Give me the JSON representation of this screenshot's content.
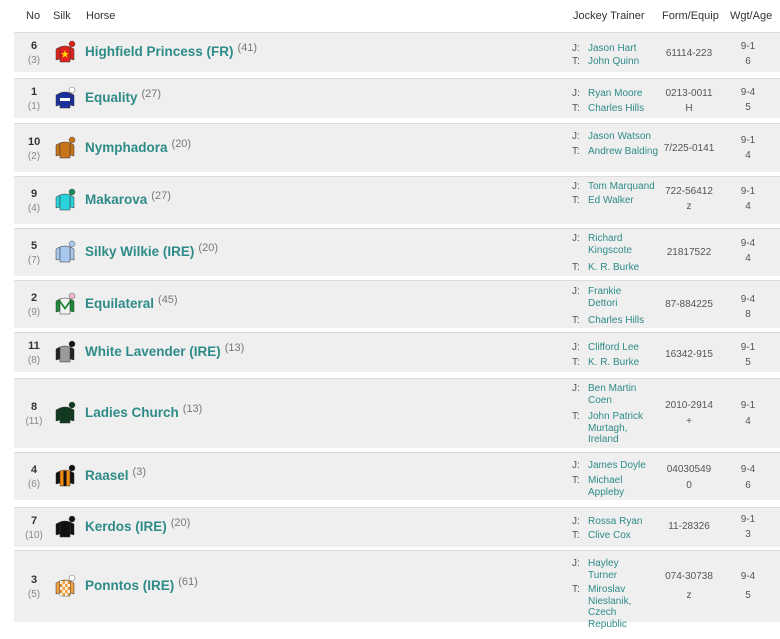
{
  "columns": {
    "no": "No",
    "silk": "Silk",
    "horse": "Horse",
    "jockey_trainer": "Jockey Trainer",
    "form_equip": "Form/Equip",
    "wgt_age": "Wgt/Age"
  },
  "labels": {
    "jockey": "J:",
    "trainer": "T:"
  },
  "runners": [
    {
      "no": "6",
      "draw": "(3)",
      "horse": "Highfield Princess (FR)",
      "age": "(41)",
      "jockey": "Jason Hart",
      "trainer": "John Quinn",
      "form": "61114-223",
      "equip": "",
      "wgt": "9-1",
      "ag": "6",
      "silk": {
        "icon": "red-silk-yellow-star-icon",
        "body": "#e0231b",
        "sleeves": "#e0231b",
        "cap": "#e0231b",
        "pattern": "star",
        "pattern_color": "#ffd700"
      }
    },
    {
      "no": "1",
      "draw": "(1)",
      "horse": "Equality",
      "age": "(27)",
      "jockey": "Ryan Moore",
      "trainer": "Charles Hills",
      "form": "0213-0011",
      "equip": "H",
      "wgt": "9-4",
      "ag": "5",
      "silk": {
        "icon": "royal-blue-silk-white-hoop-icon",
        "body": "#1a2fa0",
        "sleeves": "#1a2fa0",
        "cap": "#ffffff",
        "pattern": "hoop",
        "pattern_color": "#ffffff"
      }
    },
    {
      "no": "10",
      "draw": "(2)",
      "horse": "Nymphadora",
      "age": "(20)",
      "jockey": "Jason Watson",
      "trainer": "Andrew Balding",
      "form": "7/225-0141",
      "equip": "",
      "wgt": "9-1",
      "ag": "4",
      "silk": {
        "icon": "orange-brown-silk-icon",
        "body": "#c8741a",
        "sleeves": "#c8741a",
        "cap": "#c8741a",
        "pattern": "none",
        "pattern_color": ""
      }
    },
    {
      "no": "9",
      "draw": "(4)",
      "horse": "Makarova",
      "age": "(27)",
      "jockey": "Tom Marquand",
      "trainer": "Ed Walker",
      "form": "722-56412",
      "equip": "z",
      "wgt": "9-1",
      "ag": "4",
      "silk": {
        "icon": "turquoise-silk-icon",
        "body": "#2ad3dc",
        "sleeves": "#2ad3dc",
        "cap": "#1a8a5a",
        "pattern": "none",
        "pattern_color": ""
      }
    },
    {
      "no": "5",
      "draw": "(7)",
      "horse": "Silky Wilkie (IRE)",
      "age": "(20)",
      "jockey": "Richard Kingscote",
      "trainer": "K. R. Burke",
      "form": "21817522",
      "equip": "",
      "wgt": "9-4",
      "ag": "4",
      "silk": {
        "icon": "light-blue-silk-icon",
        "body": "#a9c8ee",
        "sleeves": "#a9c8ee",
        "cap": "#a9c8ee",
        "pattern": "none",
        "pattern_color": ""
      }
    },
    {
      "no": "2",
      "draw": "(9)",
      "horse": "Equilateral",
      "age": "(45)",
      "jockey": "Frankie Dettori",
      "trainer": "Charles Hills",
      "form": "87-884225",
      "equip": "",
      "wgt": "9-4",
      "ag": "8",
      "silk": {
        "icon": "white-silk-green-chevron-icon",
        "body": "#f2f2f2",
        "sleeves": "#1d8a3a",
        "cap": "#f4b9c8",
        "pattern": "chevron",
        "pattern_color": "#1d8a3a"
      }
    },
    {
      "no": "11",
      "draw": "(8)",
      "horse": "White Lavender (IRE)",
      "age": "(13)",
      "jockey": "Clifford Lee",
      "trainer": "K. R. Burke",
      "form": "16342-915",
      "equip": "",
      "wgt": "9-1",
      "ag": "5",
      "silk": {
        "icon": "grey-silk-black-sleeves-icon",
        "body": "#9a9a9a",
        "sleeves": "#222222",
        "cap": "#111111",
        "pattern": "none",
        "pattern_color": ""
      }
    },
    {
      "no": "8",
      "draw": "(11)",
      "horse": "Ladies Church",
      "age": "(13)",
      "jockey": "Ben Martin Coen",
      "trainer": "John Patrick Murtagh, Ireland",
      "form": "2010-2914",
      "equip": "+",
      "wgt": "9-1",
      "ag": "4",
      "silk": {
        "icon": "dark-green-silk-icon",
        "body": "#0f3a1f",
        "sleeves": "#0f3a1f",
        "cap": "#0f3a1f",
        "pattern": "none",
        "pattern_color": ""
      }
    },
    {
      "no": "4",
      "draw": "(6)",
      "horse": "Raasel",
      "age": "(3)",
      "jockey": "James Doyle",
      "trainer": "Michael Appleby",
      "form": "04030549",
      "equip": "0",
      "wgt": "9-4",
      "ag": "6",
      "silk": {
        "icon": "black-orange-silk-icon",
        "body": "#f08a12",
        "sleeves": "#111111",
        "cap": "#111111",
        "pattern": "stripe",
        "pattern_color": "#111111"
      }
    },
    {
      "no": "7",
      "draw": "(10)",
      "horse": "Kerdos (IRE)",
      "age": "(20)",
      "jockey": "Rossa Ryan",
      "trainer": "Clive Cox",
      "form": "11-28326",
      "equip": "",
      "wgt": "9-1",
      "ag": "3",
      "silk": {
        "icon": "black-silk-icon",
        "body": "#111111",
        "sleeves": "#111111",
        "cap": "#111111",
        "pattern": "none",
        "pattern_color": ""
      }
    },
    {
      "no": "3",
      "draw": "(5)",
      "horse": "Ponntos (IRE)",
      "age": "(61)",
      "jockey": "Hayley Turner",
      "trainer": "Miroslav Nieslanik, Czech Republic",
      "form": "074-30738",
      "equip": "z",
      "wgt": "9-4",
      "ag": "5",
      "silk": {
        "icon": "orange-check-silk-icon",
        "body": "#f0a040",
        "sleeves": "#f0a040",
        "cap": "#ffffff",
        "pattern": "check",
        "pattern_color": "#ffffff"
      }
    }
  ]
}
